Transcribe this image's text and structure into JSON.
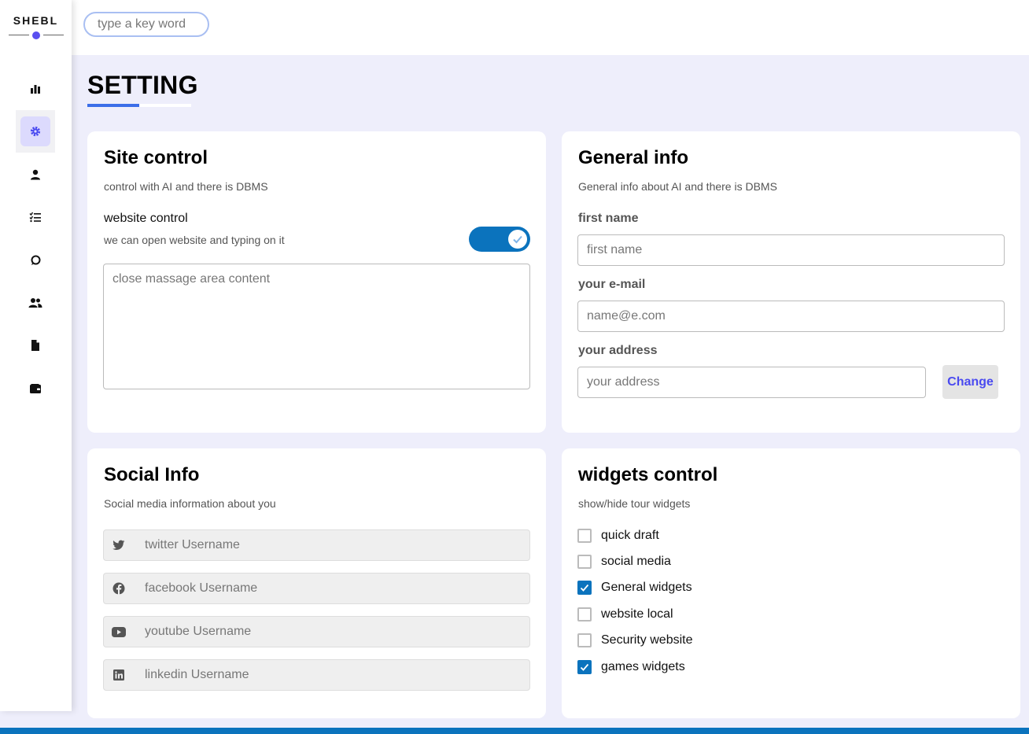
{
  "brand": {
    "name": "SHEBL"
  },
  "search": {
    "placeholder": "type a key word"
  },
  "page": {
    "title": "SETTING"
  },
  "sidebar": {
    "items": [
      {
        "name": "dashboard",
        "icon": "bar-chart-icon",
        "active": false
      },
      {
        "name": "settings",
        "icon": "gear-icon",
        "active": true
      },
      {
        "name": "profile",
        "icon": "user-icon",
        "active": false
      },
      {
        "name": "projects",
        "icon": "checklist-icon",
        "active": false
      },
      {
        "name": "messages",
        "icon": "chat-bubble-icon",
        "active": false
      },
      {
        "name": "friends",
        "icon": "users-icon",
        "active": false
      },
      {
        "name": "files",
        "icon": "file-icon",
        "active": false
      },
      {
        "name": "plans",
        "icon": "wallet-icon",
        "active": false
      }
    ]
  },
  "site_control": {
    "title": "Site control",
    "desc": "control with AI and there is DBMS",
    "website_control_label": "website control",
    "website_control_sub": "we can open website and typing on it",
    "toggle_on": true,
    "message_placeholder": "close massage area content"
  },
  "general_info": {
    "title": "General info",
    "desc": "General info about AI and there is DBMS",
    "first_name_label": "first name",
    "first_name_placeholder": "first name",
    "email_label": "your e-mail",
    "email_placeholder": "name@e.com",
    "address_label": "your address",
    "address_placeholder": "your address",
    "change_button": "Change"
  },
  "social_info": {
    "title": "Social Info",
    "desc": "Social media information about you",
    "rows": [
      {
        "icon": "twitter-icon",
        "placeholder": "twitter Username"
      },
      {
        "icon": "facebook-icon",
        "placeholder": "facebook Username"
      },
      {
        "icon": "youtube-icon",
        "placeholder": "youtube Username"
      },
      {
        "icon": "linkedin-icon",
        "placeholder": "linkedin Username"
      }
    ]
  },
  "widgets_control": {
    "title": "widgets control",
    "desc": "show/hide tour widgets",
    "items": [
      {
        "label": "quick draft",
        "checked": false
      },
      {
        "label": "social media",
        "checked": false
      },
      {
        "label": "General widgets",
        "checked": true
      },
      {
        "label": "website local",
        "checked": false
      },
      {
        "label": "Security website",
        "checked": false
      },
      {
        "label": "games widgets",
        "checked": true
      }
    ]
  },
  "colors": {
    "accent": "#3c6ee8",
    "toggle": "#0b73bd",
    "brand_dot": "#5a4ff0",
    "page_bg": "#eeeefb"
  }
}
